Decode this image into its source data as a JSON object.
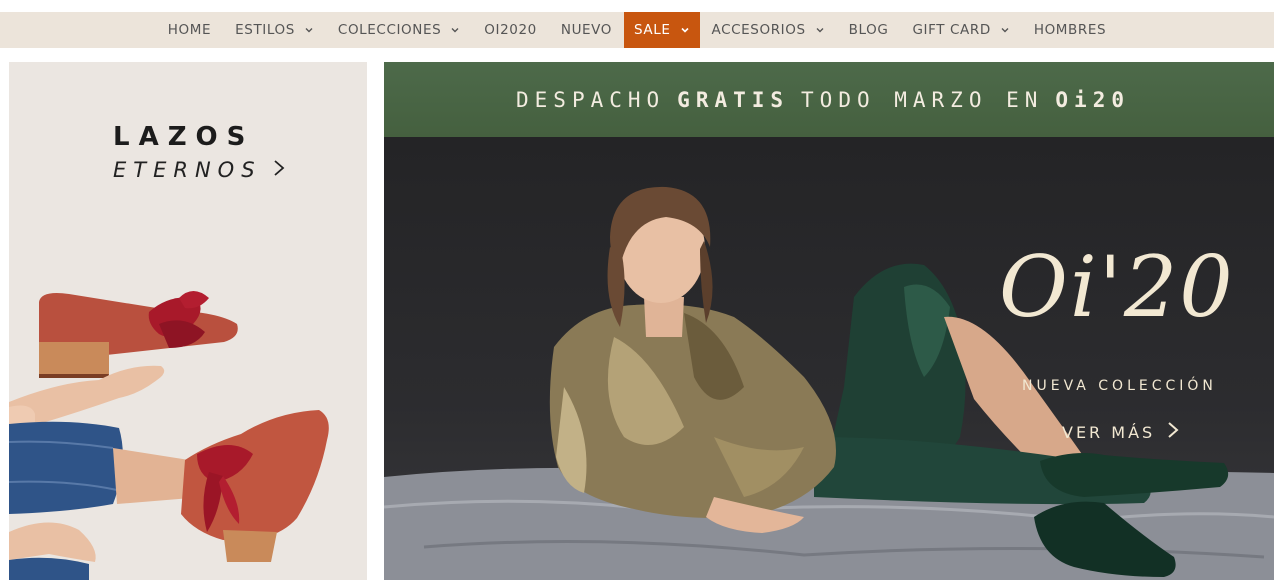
{
  "nav": {
    "items": [
      {
        "label": "HOME",
        "dropdown": false
      },
      {
        "label": "ESTILOS",
        "dropdown": true
      },
      {
        "label": "COLECCIONES",
        "dropdown": true
      },
      {
        "label": "OI2020",
        "dropdown": false
      },
      {
        "label": "NUEVO",
        "dropdown": false
      },
      {
        "label": "SALE",
        "dropdown": true,
        "highlight": true
      },
      {
        "label": "ACCESORIOS",
        "dropdown": true
      },
      {
        "label": "BLOG",
        "dropdown": false
      },
      {
        "label": "GIFT CARD",
        "dropdown": true
      },
      {
        "label": "HOMBRES",
        "dropdown": false
      }
    ]
  },
  "left_banner": {
    "title": "LAZOS",
    "subtitle": "ETERNOS"
  },
  "promo": {
    "part1": "DESPACHO",
    "bold1": "GRATIS",
    "part2": "TODO MARZO EN",
    "bold2": "Oi20"
  },
  "hero": {
    "brand": "Oi'20",
    "subtitle": "NUEVA COLECCIÓN",
    "cta": "VER MÁS"
  },
  "colors": {
    "nav_bg": "#ece4da",
    "sale_bg": "#c8560f",
    "promo_bg": "#4d6a4a",
    "brand_text": "#f2e8d2"
  }
}
